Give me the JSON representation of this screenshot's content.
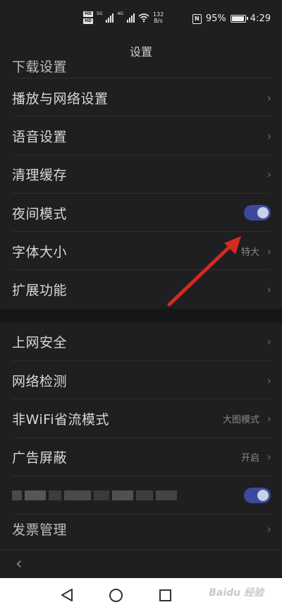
{
  "status_bar": {
    "hd1": "HD",
    "hd2": "HD",
    "net1": "5G",
    "net2": "4G",
    "speed_value": "132",
    "speed_unit": "B/s",
    "nfc": "N",
    "battery": "95%",
    "time": "4:29"
  },
  "title": "设置",
  "list": {
    "partial_top": "下载设置",
    "items_group1": [
      {
        "label": "播放与网络设置",
        "value": ""
      },
      {
        "label": "语音设置",
        "value": ""
      },
      {
        "label": "清理缓存",
        "value": ""
      },
      {
        "label": "夜间模式",
        "toggle": true
      },
      {
        "label": "字体大小",
        "value": "特大"
      },
      {
        "label": "扩展功能",
        "value": ""
      }
    ],
    "items_group2": [
      {
        "label": "上网安全",
        "value": ""
      },
      {
        "label": "网络检测",
        "value": ""
      },
      {
        "label": "非WiFi省流模式",
        "value": "大图模式"
      },
      {
        "label": "广告屏蔽",
        "value": "开启"
      }
    ],
    "partial_bottom": "发票管理",
    "chevron": "›",
    "night_mode_on": true,
    "blurred_toggle_on": true
  },
  "back_symbol": "‹",
  "watermark": "Baidu 经验",
  "colors": {
    "background": "#1f1f21",
    "toggle_on": "#3b4a9a",
    "arrow": "#d42a22"
  }
}
